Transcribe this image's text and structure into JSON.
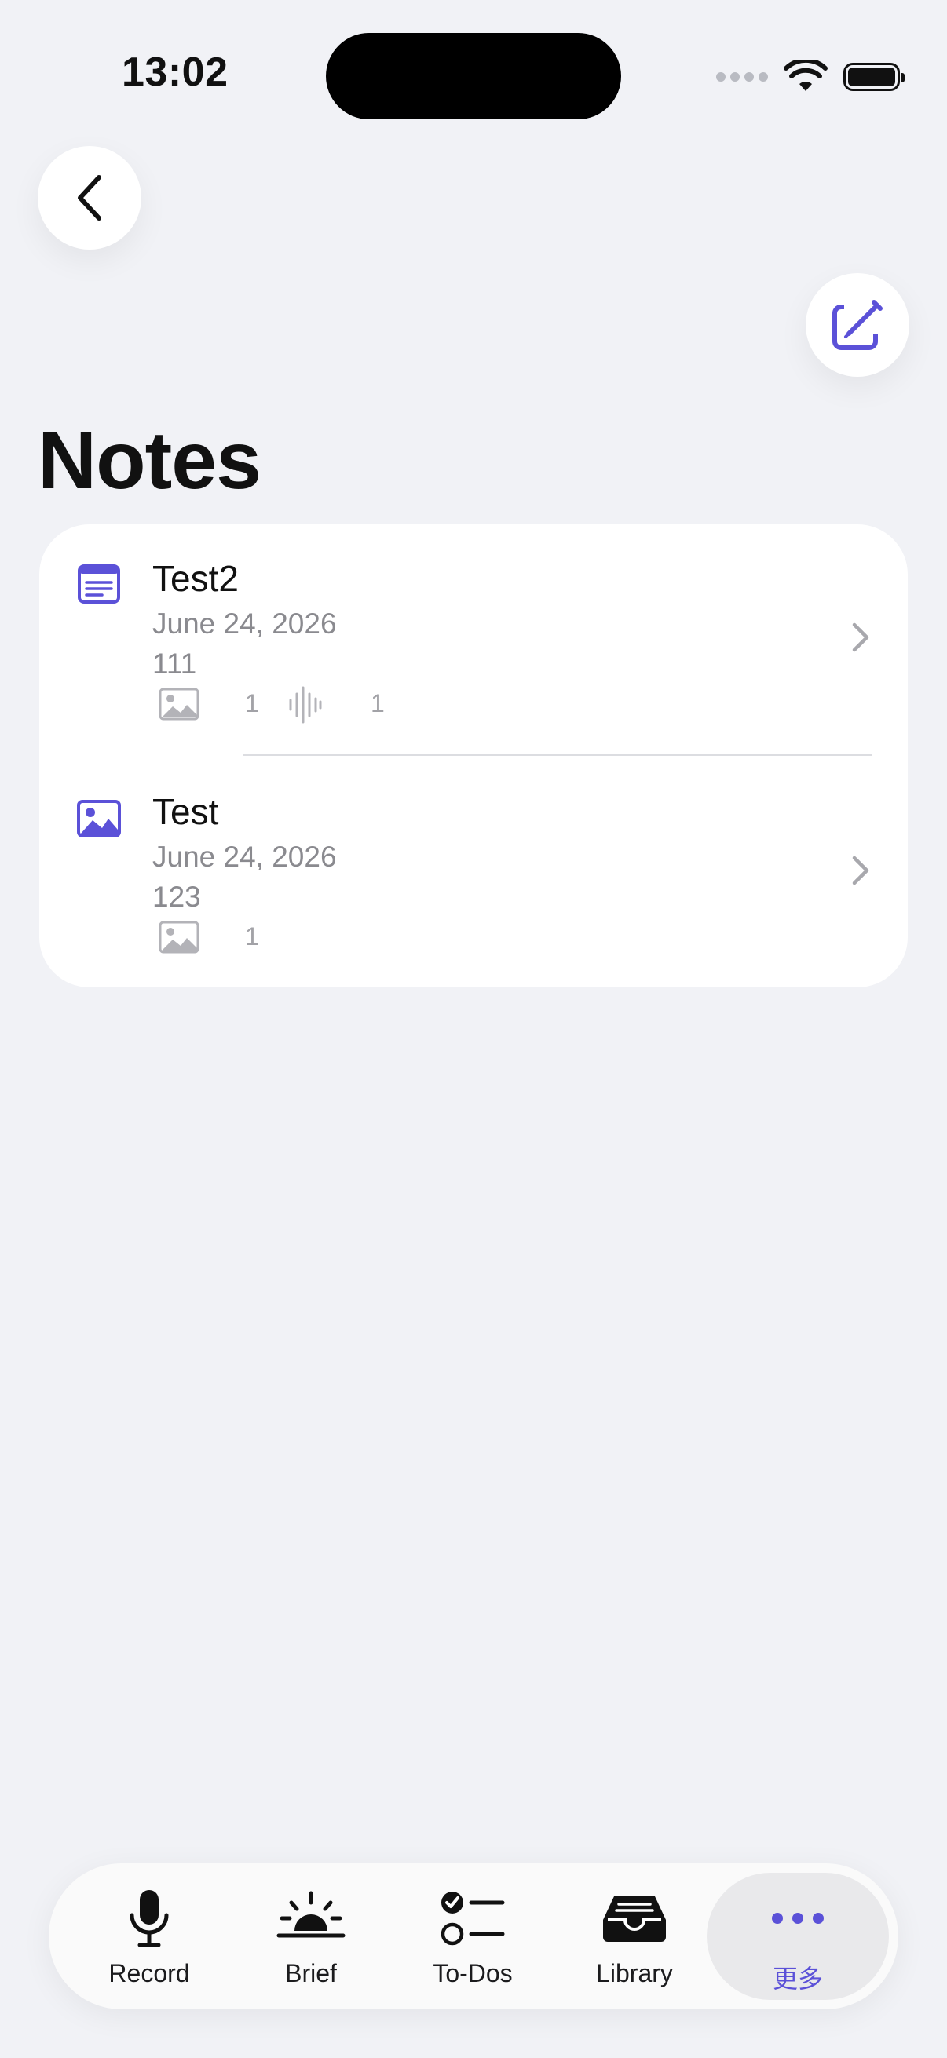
{
  "status_bar": {
    "time": "13:02"
  },
  "page": {
    "title": "Notes"
  },
  "notes": [
    {
      "title": "Test2",
      "date": "June 24, 2026",
      "preview": "111",
      "image_count": "1",
      "audio_count": "1",
      "type_icon": "document-icon"
    },
    {
      "title": "Test",
      "date": "June 24, 2026",
      "preview": "123",
      "image_count": "1",
      "type_icon": "photo-icon"
    }
  ],
  "tab_bar": {
    "items": [
      {
        "label": "Record",
        "icon": "microphone-icon"
      },
      {
        "label": "Brief",
        "icon": "sunrise-icon"
      },
      {
        "label": "To-Dos",
        "icon": "checklist-icon"
      },
      {
        "label": "Library",
        "icon": "tray-icon"
      },
      {
        "label": "更多",
        "icon": "more-icon"
      }
    ],
    "active_index": 4
  },
  "colors": {
    "accent": "#5b51d8",
    "background": "#f1f2f6",
    "secondary_text": "#8a8a8f"
  }
}
